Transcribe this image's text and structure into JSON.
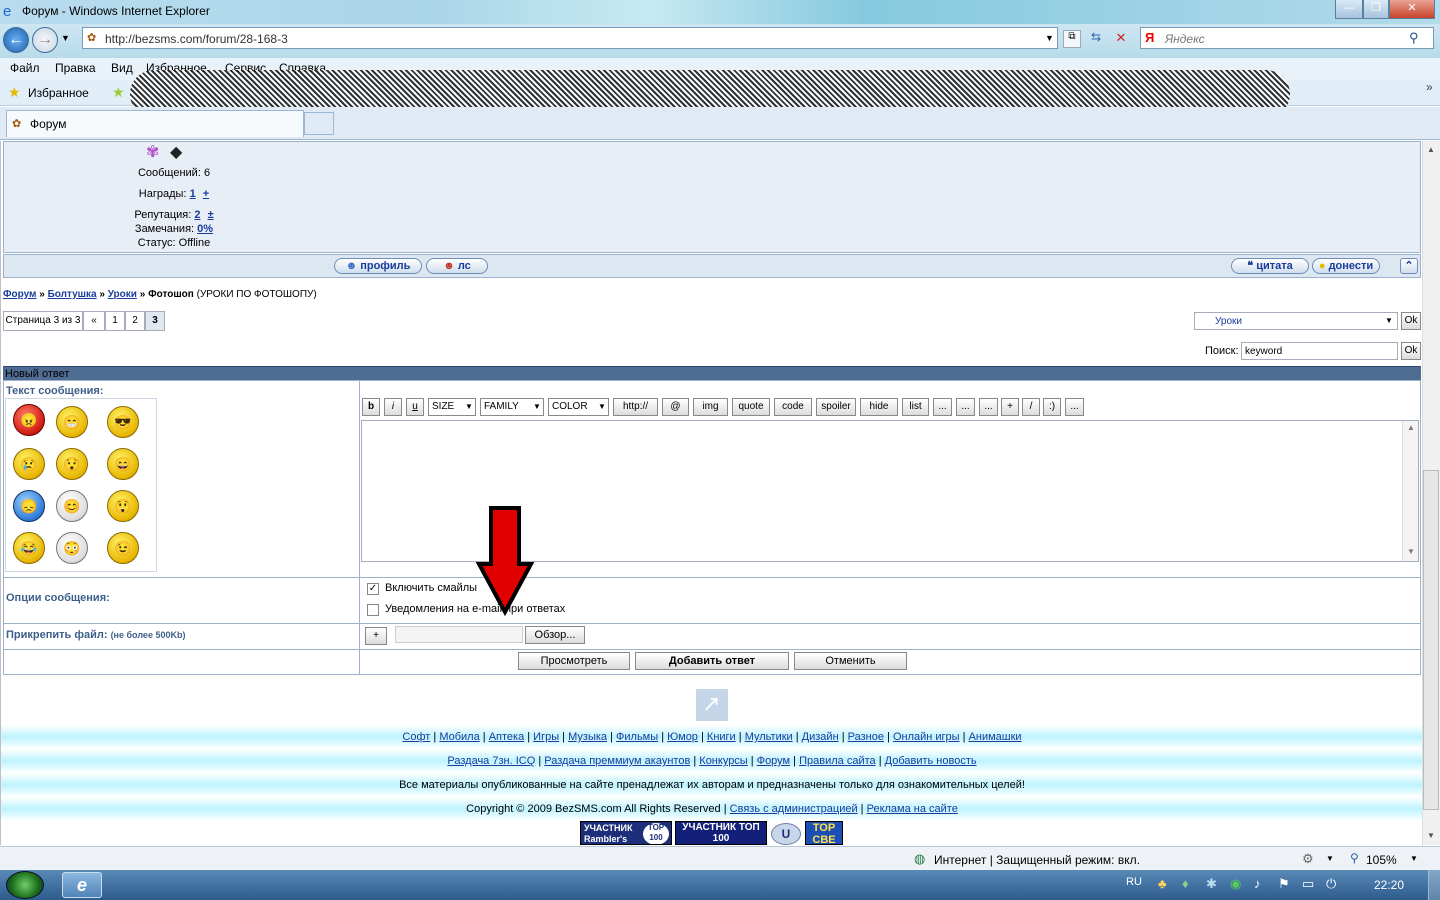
{
  "window": {
    "title": "Форум - Windows Internet Explorer"
  },
  "address": {
    "url": "http://bezsms.com/forum/28-168-3",
    "search_placeholder": "Яндекс"
  },
  "menu": [
    "Файл",
    "Правка",
    "Вид",
    "Избранное",
    "Сервис",
    "Справка"
  ],
  "favorites": {
    "label": "Избранное"
  },
  "tab": {
    "label": "Форум"
  },
  "profile": {
    "messages": "Сообщений: 6",
    "awards_label": "Награды:",
    "awards_value": "1",
    "plus": "+",
    "rep_label": "Репутация:",
    "rep_value": "2",
    "plusminus": "±",
    "warn_label": "Замечания:",
    "warn_value": "0%",
    "status": "Статус: Offline"
  },
  "post_buttons": {
    "profile": "профиль",
    "pm": "лс",
    "quote": "цитата",
    "report": "донести"
  },
  "breadcrumb": {
    "forum": "Форум",
    "sep": "»",
    "chat": "Болтушка",
    "lessons": "Уроки",
    "topic": "Фотошоп",
    "topic_desc": "(УРОКИ ПО ФОТОШОПУ)"
  },
  "pager": {
    "label": "Страница 3 из 3",
    "prev": "«",
    "p1": "1",
    "p2": "2",
    "p3": "3"
  },
  "forum_jump": {
    "selected": "Уроки",
    "ok": "Ok"
  },
  "search": {
    "label": "Поиск:",
    "value": "keyword",
    "ok": "Ok"
  },
  "reply": {
    "header": "Новый ответ",
    "text_label": "Текст сообщения:",
    "toolbar": [
      "b",
      "i",
      "u",
      "SIZE",
      "FAMILY",
      "COLOR",
      "http://",
      "@",
      "img",
      "quote",
      "code",
      "spoiler",
      "hide",
      "list",
      "...",
      "...",
      "...",
      "+",
      "/",
      ":)",
      "..."
    ],
    "options_label": "Опции сообщения:",
    "opt_smiles": "Включить смайлы",
    "opt_notify": "Уведомления на e-mail при ответах",
    "attach_label": "Прикрепить файл:",
    "attach_note": "(не более 500Kb)",
    "attach_plus": "+",
    "browse": "Обзор...",
    "preview": "Просмотреть",
    "submit": "Добавить ответ",
    "cancel": "Отменить"
  },
  "footer": {
    "links1": [
      "Софт",
      "Мобила",
      "Аптека",
      "Игры",
      "Музыка",
      "Фильмы",
      "Юмор",
      "Книги",
      "Мультики",
      "Дизайн",
      "Разное",
      "Онлайн игры",
      "Анимашки"
    ],
    "links2": [
      "Раздача 7зн. ICQ",
      "Раздача преммиум акаунтов",
      "Конкурсы",
      "Форум",
      "Правила сайта",
      "Добавить новость"
    ],
    "notice": "Все материалы опубликованные на сайте пренадлежат их авторам и предназначены только для ознакомительных целей!",
    "copyright": "Copyright © 2009 BezSMS.com All Rights Reserved",
    "contact": "Связь с администрацией",
    "ads": "Реклама на сайте",
    "badge_rambler": "УЧАСТНИК Rambler's",
    "badge_rambler_top": "TOP 100",
    "badge_top100": "УЧАСТНИК ТОП 100",
    "badge_topcbe": "TOP CBE"
  },
  "status": {
    "zone": "Интернет | Защищенный режим: вкл.",
    "zoom": "105%"
  },
  "taskbar": {
    "lang": "RU",
    "time": "22:20"
  },
  "colors": {
    "header_bar": "#4f6c93",
    "label_blue": "#3e5f8a",
    "link": "#1a3c9a",
    "arrow": "#e00000"
  }
}
